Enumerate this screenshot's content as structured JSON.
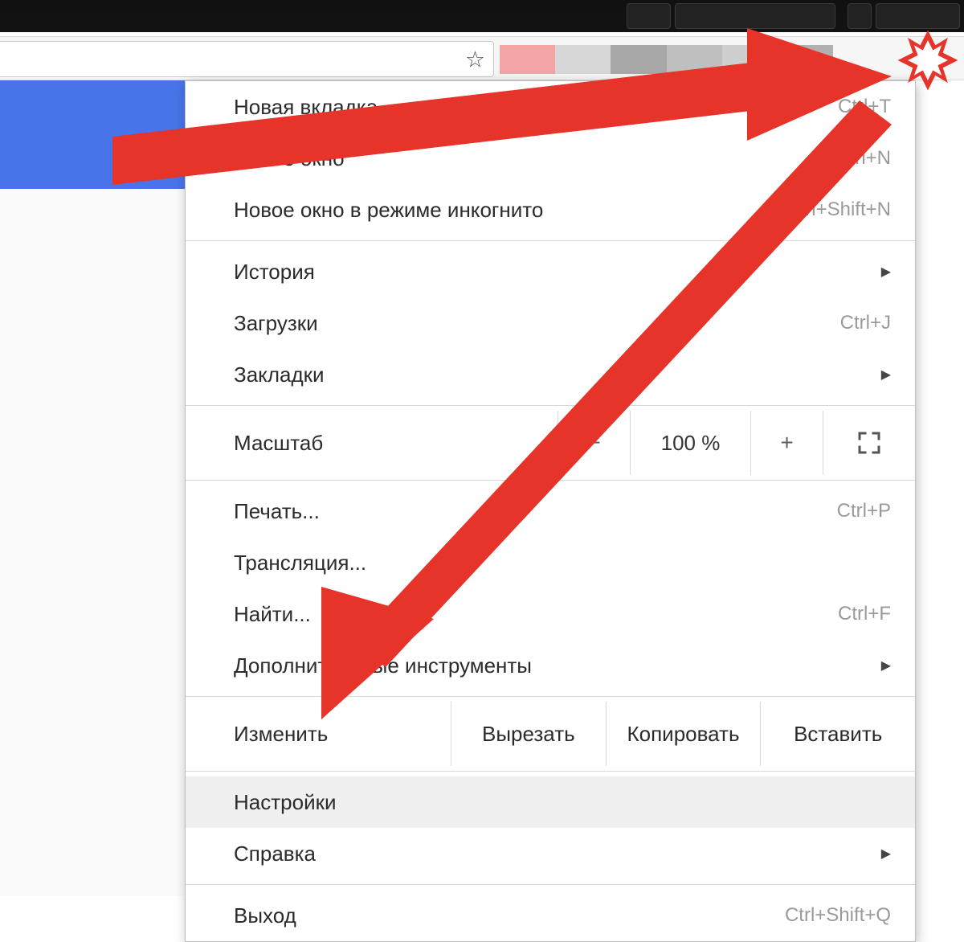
{
  "menu_button_name": "chrome-menu-button",
  "menu": {
    "new_tab": {
      "label": "Новая вкладка",
      "shortcut": "Ctrl+T"
    },
    "new_window": {
      "label": "Новое окно",
      "shortcut": "Ctrl+N"
    },
    "incognito": {
      "label": "Новое окно в режиме инкогнито",
      "shortcut": "Ctrl+Shift+N"
    },
    "history": {
      "label": "История"
    },
    "downloads": {
      "label": "Загрузки",
      "shortcut": "Ctrl+J"
    },
    "bookmarks": {
      "label": "Закладки"
    },
    "zoom": {
      "label": "Масштаб",
      "value": "100 %",
      "minus": "−",
      "plus": "+"
    },
    "print": {
      "label": "Печать...",
      "shortcut": "Ctrl+P"
    },
    "cast": {
      "label": "Трансляция..."
    },
    "find": {
      "label": "Найти...",
      "shortcut": "Ctrl+F"
    },
    "more_tools": {
      "label": "Дополнительные инструменты"
    },
    "edit": {
      "label": "Изменить",
      "cut": "Вырезать",
      "copy": "Копировать",
      "paste": "Вставить"
    },
    "settings": {
      "label": "Настройки"
    },
    "help": {
      "label": "Справка"
    },
    "exit": {
      "label": "Выход",
      "shortcut": "Ctrl+Shift+Q"
    }
  },
  "colors": {
    "annotation": "#e6342a",
    "accent": "#4973e8"
  }
}
